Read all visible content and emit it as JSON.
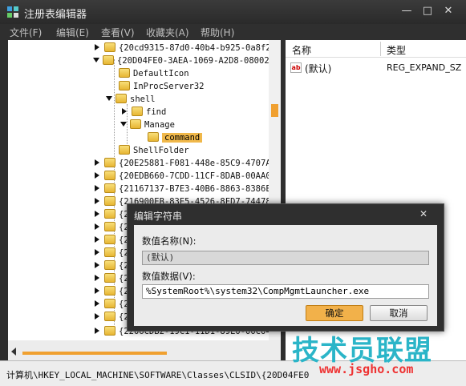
{
  "window": {
    "title": "注册表编辑器",
    "min_symbol": "—",
    "max_symbol": "□",
    "close_symbol": "✕"
  },
  "menu": [
    "文件(F)",
    "编辑(E)",
    "查看(V)",
    "收藏夹(A)",
    "帮助(H)"
  ],
  "tree": {
    "items": [
      {
        "label": "{20cd9315-87d0-40b4-b925-0a8f2C",
        "state": "collapsed"
      },
      {
        "label": "{20D04FE0-3AEA-1069-A2D8-08002B",
        "state": "expanded"
      },
      {
        "label": "DefaultIcon",
        "state": "leaf"
      },
      {
        "label": "InProcServer32",
        "state": "leaf"
      },
      {
        "label": "shell",
        "state": "expanded"
      },
      {
        "label": "find",
        "state": "collapsed"
      },
      {
        "label": "Manage",
        "state": "expanded"
      },
      {
        "label": "command",
        "state": "selected"
      },
      {
        "label": "ShellFolder",
        "state": "leaf"
      },
      {
        "label": "{20E25881-F081-448e-85C9-4707A9",
        "state": "collapsed"
      },
      {
        "label": "{20EDB660-7CDD-11CF-8DAB-00AA00",
        "state": "collapsed"
      },
      {
        "label": "{21167137-B7E3-40B6-8863-8386E8",
        "state": "collapsed"
      },
      {
        "label": "{216900EB-83E5-4526-8FD7-74478E",
        "state": "collapsed"
      },
      {
        "label": "{2",
        "state": "collapsed"
      },
      {
        "label": "{2",
        "state": "collapsed"
      },
      {
        "label": "{2",
        "state": "collapsed"
      },
      {
        "label": "{2",
        "state": "collapsed"
      },
      {
        "label": "{2",
        "state": "collapsed"
      },
      {
        "label": "{2",
        "state": "collapsed"
      },
      {
        "label": "{2",
        "state": "collapsed"
      },
      {
        "label": "{2",
        "state": "collapsed"
      },
      {
        "label": "{2",
        "state": "collapsed"
      },
      {
        "label": "{2206CDB2-19C1-11D1-89E0-00C04F",
        "state": "collapsed"
      }
    ]
  },
  "list": {
    "col_name": "名称",
    "col_type": "类型",
    "rows": [
      {
        "icon": "ab",
        "name": "(默认)",
        "type": "REG_EXPAND_SZ"
      }
    ]
  },
  "statusbar": {
    "path": "计算机\\HKEY_LOCAL_MACHINE\\SOFTWARE\\Classes\\CLSID\\{20D04FE0"
  },
  "dialog": {
    "title": "编辑字符串",
    "close_symbol": "✕",
    "name_label": "数值名称(N):",
    "name_value": "(默认)",
    "data_label": "数值数据(V):",
    "data_value": "%SystemRoot%\\system32\\CompMgmtLauncher.exe",
    "ok_label": "确定",
    "cancel_label": "取消"
  },
  "watermark": {
    "big": "技术员联盟",
    "url": "www.jsgho.com"
  }
}
